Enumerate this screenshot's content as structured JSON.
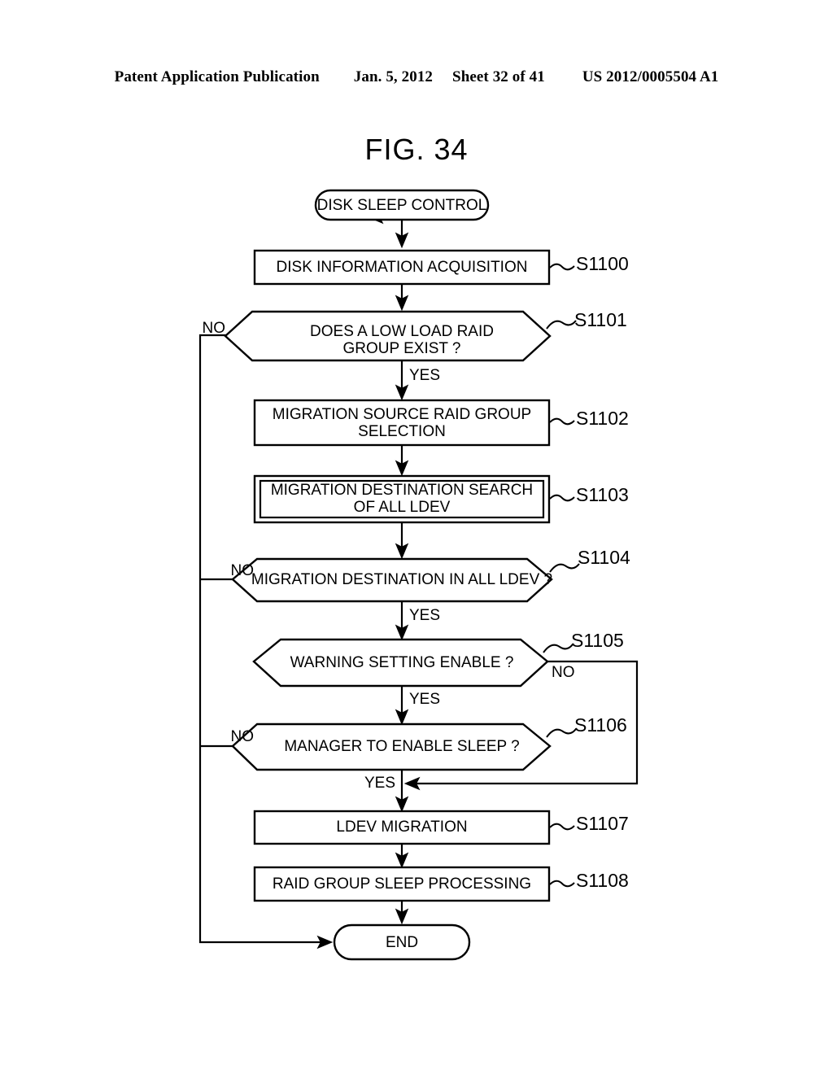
{
  "header": {
    "publication": "Patent Application Publication",
    "date": "Jan. 5, 2012",
    "sheet": "Sheet 32 of 41",
    "number": "US 2012/0005504 A1"
  },
  "figure": {
    "title": "FIG. 34"
  },
  "chart_data": {
    "type": "diagram",
    "diagram_kind": "flowchart",
    "title": "FIG. 34",
    "orientation": "top-to-bottom",
    "nodes": [
      {
        "id": "start",
        "shape": "terminator",
        "text": "DISK SLEEP CONTROL",
        "step": ""
      },
      {
        "id": "s1100",
        "shape": "process",
        "text": "DISK INFORMATION ACQUISITION",
        "step": "S1100"
      },
      {
        "id": "s1101",
        "shape": "decision-hexagon",
        "text": "DOES A LOW LOAD RAID\nGROUP EXIST ?",
        "step": "S1101"
      },
      {
        "id": "s1102",
        "shape": "process",
        "text": "MIGRATION SOURCE RAID GROUP\nSELECTION",
        "step": "S1102"
      },
      {
        "id": "s1103",
        "shape": "predefined-process",
        "text": "MIGRATION DESTINATION SEARCH\nOF ALL LDEV",
        "step": "S1103"
      },
      {
        "id": "s1104",
        "shape": "decision-hexagon",
        "text": "MIGRATION DESTINATION IN ALL LDEV ?",
        "step": "S1104"
      },
      {
        "id": "s1105",
        "shape": "decision-hexagon",
        "text": "WARNING SETTING ENABLE ?",
        "step": "S1105"
      },
      {
        "id": "s1106",
        "shape": "decision-hexagon",
        "text": "MANAGER TO ENABLE SLEEP ?",
        "step": "S1106"
      },
      {
        "id": "s1107",
        "shape": "process",
        "text": "LDEV MIGRATION",
        "step": "S1107"
      },
      {
        "id": "s1108",
        "shape": "process",
        "text": "RAID GROUP SLEEP PROCESSING",
        "step": "S1108"
      },
      {
        "id": "end",
        "shape": "terminator",
        "text": "END",
        "step": ""
      }
    ],
    "edges": [
      {
        "from": "start",
        "to": "s1100",
        "label": ""
      },
      {
        "from": "s1100",
        "to": "s1101",
        "label": ""
      },
      {
        "from": "s1101",
        "to": "s1102",
        "label": "YES"
      },
      {
        "from": "s1101",
        "to": "end",
        "label": "NO"
      },
      {
        "from": "s1102",
        "to": "s1103",
        "label": ""
      },
      {
        "from": "s1103",
        "to": "s1104",
        "label": ""
      },
      {
        "from": "s1104",
        "to": "s1105",
        "label": "YES"
      },
      {
        "from": "s1104",
        "to": "end",
        "label": "NO"
      },
      {
        "from": "s1105",
        "to": "s1106",
        "label": "YES"
      },
      {
        "from": "s1105",
        "to": "s1107",
        "label": "NO"
      },
      {
        "from": "s1106",
        "to": "s1107",
        "label": "YES"
      },
      {
        "from": "s1106",
        "to": "end",
        "label": "NO"
      },
      {
        "from": "s1107",
        "to": "s1108",
        "label": ""
      },
      {
        "from": "s1108",
        "to": "end",
        "label": ""
      }
    ]
  },
  "nodes": {
    "start": {
      "text": "DISK SLEEP CONTROL"
    },
    "s1100": {
      "text": "DISK INFORMATION ACQUISITION",
      "step": "S1100"
    },
    "s1101": {
      "line1": "DOES A LOW LOAD RAID",
      "line2": "GROUP EXIST ?",
      "step": "S1101"
    },
    "s1102": {
      "line1": "MIGRATION SOURCE RAID GROUP",
      "line2": "SELECTION",
      "step": "S1102"
    },
    "s1103": {
      "line1": "MIGRATION DESTINATION SEARCH",
      "line2": "OF ALL LDEV",
      "step": "S1103"
    },
    "s1104": {
      "text": "MIGRATION DESTINATION IN ALL LDEV ?",
      "step": "S1104"
    },
    "s1105": {
      "text": "WARNING SETTING ENABLE ?",
      "step": "S1105"
    },
    "s1106": {
      "text": "MANAGER TO ENABLE SLEEP ?",
      "step": "S1106"
    },
    "s1107": {
      "text": "LDEV MIGRATION",
      "step": "S1107"
    },
    "s1108": {
      "text": "RAID GROUP SLEEP PROCESSING",
      "step": "S1108"
    },
    "end": {
      "text": "END"
    }
  },
  "edge_labels": {
    "no_s1101": "NO",
    "yes_s1101": "YES",
    "no_s1104": "NO",
    "yes_s1104": "YES",
    "no_s1105": "NO",
    "yes_s1105": "YES",
    "no_s1106": "NO",
    "yes_s1106": "YES"
  },
  "colors": {
    "ink": "#000000",
    "paper": "#ffffff"
  }
}
